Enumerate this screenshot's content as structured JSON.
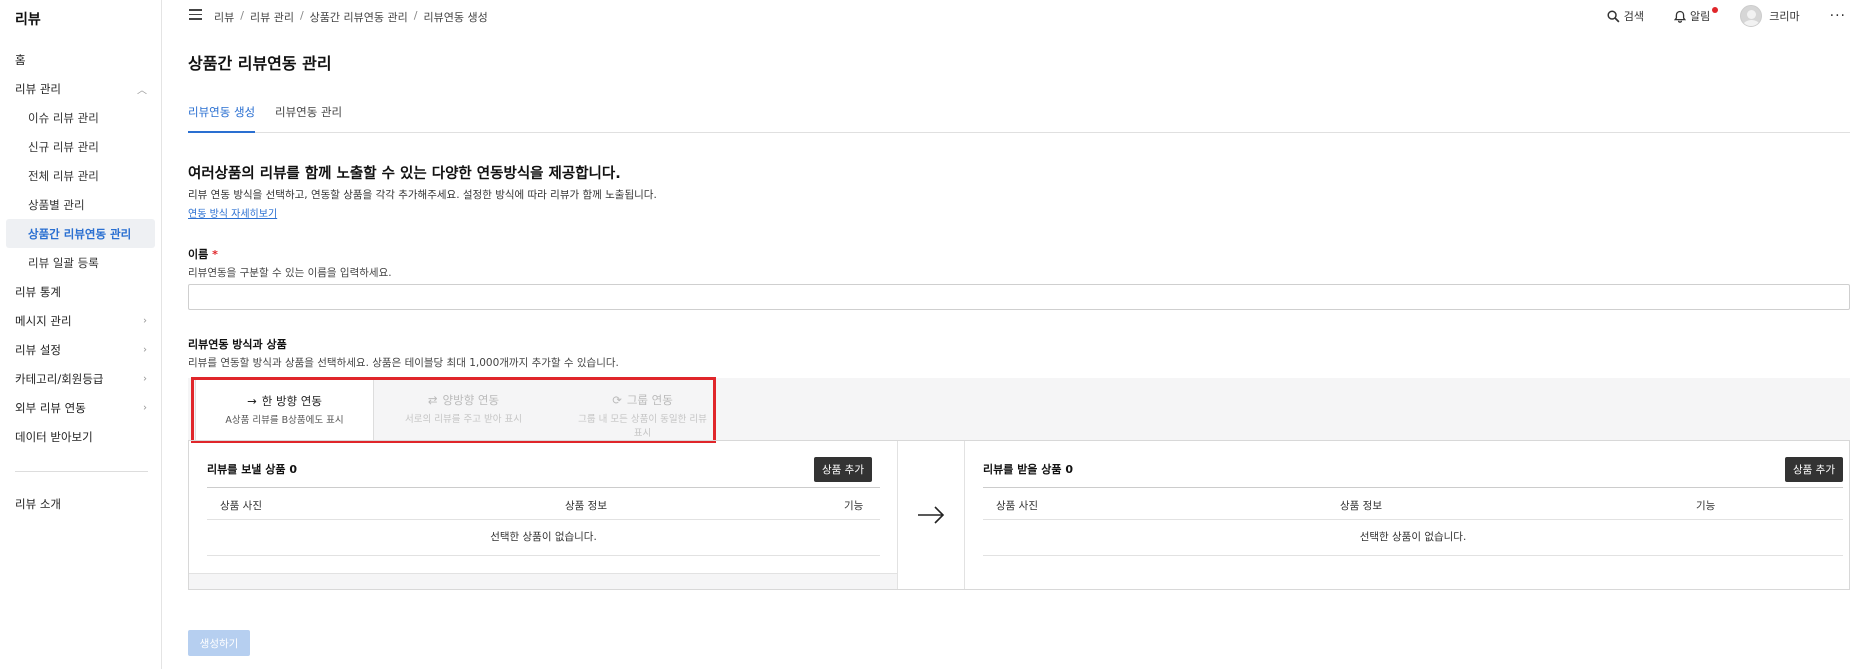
{
  "sidebar": {
    "brand": "리뷰",
    "items": [
      {
        "label": "홈"
      },
      {
        "label": "리뷰 관리"
      },
      {
        "label": "이슈 리뷰 관리"
      },
      {
        "label": "신규 리뷰 관리"
      },
      {
        "label": "전체 리뷰 관리"
      },
      {
        "label": "상품별 관리"
      },
      {
        "label": "상품간 리뷰연동 관리"
      },
      {
        "label": "리뷰 일괄 등록"
      },
      {
        "label": "리뷰 통계"
      },
      {
        "label": "메시지 관리"
      },
      {
        "label": "리뷰 설정"
      },
      {
        "label": "카테고리/회원등급"
      },
      {
        "label": "외부 리뷰 연동"
      },
      {
        "label": "데이터 받아보기"
      }
    ],
    "about": "리뷰 소개"
  },
  "topbar": {
    "breadcrumb": [
      "리뷰",
      "리뷰 관리",
      "상품간 리뷰연동 관리",
      "리뷰연동 생성"
    ],
    "search_label": "검색",
    "alarm_label": "알림",
    "user_name": "크리마",
    "more": "···"
  },
  "page": {
    "title": "상품간 리뷰연동 관리",
    "tabs": [
      "리뷰연동 생성",
      "리뷰연동 관리"
    ],
    "headline": "여러상품의 리뷰를 함께 노출할 수 있는 다양한 연동방식을 제공합니다.",
    "description": "리뷰 연동 방식을 선택하고, 연동할 상품을 각각 추가해주세요. 설정한 방식에 따라 리뷰가 함께 노출됩니다.",
    "link": "연동 방식 자세히보기"
  },
  "name_field": {
    "label": "이름",
    "required_mark": "*",
    "help": "리뷰연동을 구분할 수 있는 이름을 입력하세요.",
    "value": "",
    "placeholder": ""
  },
  "method_section": {
    "label": "리뷰연동 방식과 상품",
    "help": "리뷰를 연동할 방식과 상품을 선택하세요. 상품은 테이블당 최대 1,000개까지 추가할 수 있습니다.",
    "methods": [
      {
        "title": "한 방향 연동",
        "sub": "A상품 리뷰를 B상품에도 표시",
        "icon": "→"
      },
      {
        "title": "양방향 연동",
        "sub": "서로의 리뷰를 주고 받아 표시",
        "icon": "⇄"
      },
      {
        "title": "그룹 연동",
        "sub": "그룹 내 모든 상품이 동일한 리뷰 표시",
        "icon": "⟳"
      }
    ]
  },
  "panels": {
    "left": {
      "title": "리뷰를 보낼 상품 0",
      "add_label": "상품 추가",
      "col_photo": "상품 사진",
      "col_info": "상품 정보",
      "col_func": "기능",
      "empty": "선택한 상품이 없습니다."
    },
    "right": {
      "title": "리뷰를 받을 상품 0",
      "add_label": "상품 추가",
      "col_photo": "상품 사진",
      "col_info": "상품 정보",
      "col_func": "기능",
      "empty": "선택한 상품이 없습니다."
    }
  },
  "create_button": "생성하기",
  "colors": {
    "accent": "#2a6fd1",
    "highlight": "#e0262a",
    "dark_button": "#333333",
    "disabled_button": "#b6cff0"
  }
}
